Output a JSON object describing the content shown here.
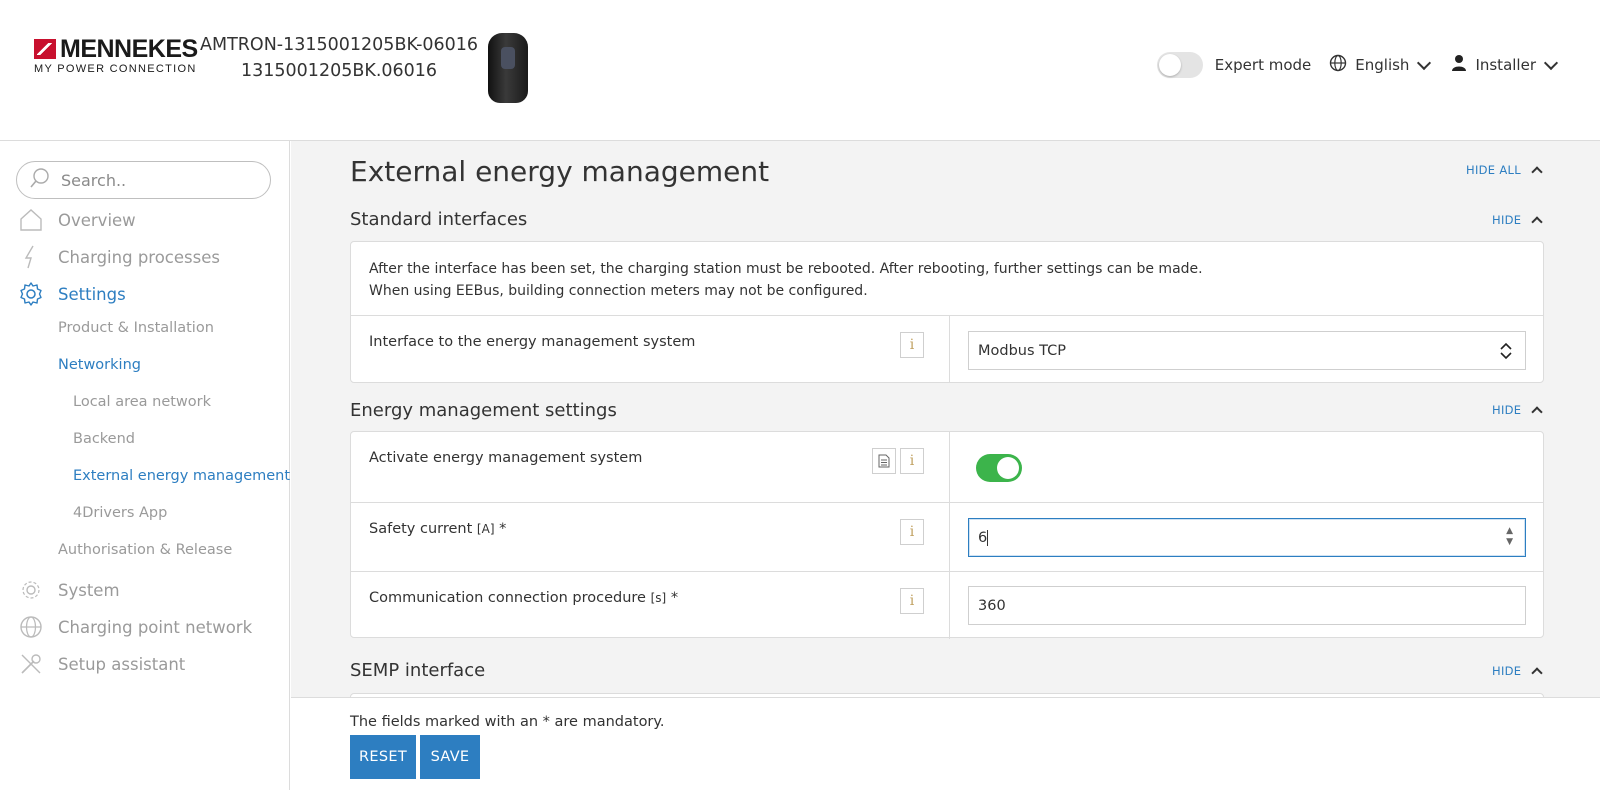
{
  "brand": {
    "name": "MENNEKES",
    "tagline": "MY POWER CONNECTION"
  },
  "device": {
    "model": "AMTRON-1315001205BK-06016",
    "serial": "1315001205BK.06016"
  },
  "header": {
    "expert_mode_label": "Expert mode",
    "language": "English",
    "user_role": "Installer"
  },
  "sidebar": {
    "search_placeholder": "Search..",
    "items": {
      "overview": "Overview",
      "charging_processes": "Charging processes",
      "settings": "Settings",
      "product_installation": "Product & Installation",
      "networking": "Networking",
      "local_area_network": "Local area network",
      "backend": "Backend",
      "external_energy_management": "External energy management",
      "drivers_app": "4Drivers App",
      "authorisation_release": "Authorisation & Release",
      "system": "System",
      "charging_point_network": "Charging point network",
      "setup_assistant": "Setup assistant"
    }
  },
  "main": {
    "title": "External energy management",
    "hide_all": "HIDE ALL",
    "hide": "HIDE",
    "standard_interfaces": {
      "title": "Standard interfaces",
      "notice_line1": "After the interface has been set, the charging station must be rebooted. After rebooting, further settings can be made.",
      "notice_line2": "When using EEBus, building connection meters may not be configured.",
      "interface_label": "Interface to the energy management system",
      "interface_value": "Modbus TCP"
    },
    "energy_management_settings": {
      "title": "Energy management settings",
      "activate_label": "Activate energy management system",
      "activate_value": true,
      "safety_current_label": "Safety current",
      "safety_current_unit": "[A]",
      "safety_current_value": "6",
      "comm_label": "Communication connection procedure",
      "comm_unit": "[s]",
      "comm_value": "360"
    },
    "semp": {
      "title": "SEMP interface"
    }
  },
  "footer": {
    "note": "The fields marked with an * are mandatory.",
    "reset": "RESET",
    "save": "SAVE"
  },
  "info_glyph": "i",
  "mandatory_mark": "*",
  "colors": {
    "accent": "#2d7ec1",
    "toggle_on": "#3cb44b",
    "brand_red": "#c8102e"
  }
}
